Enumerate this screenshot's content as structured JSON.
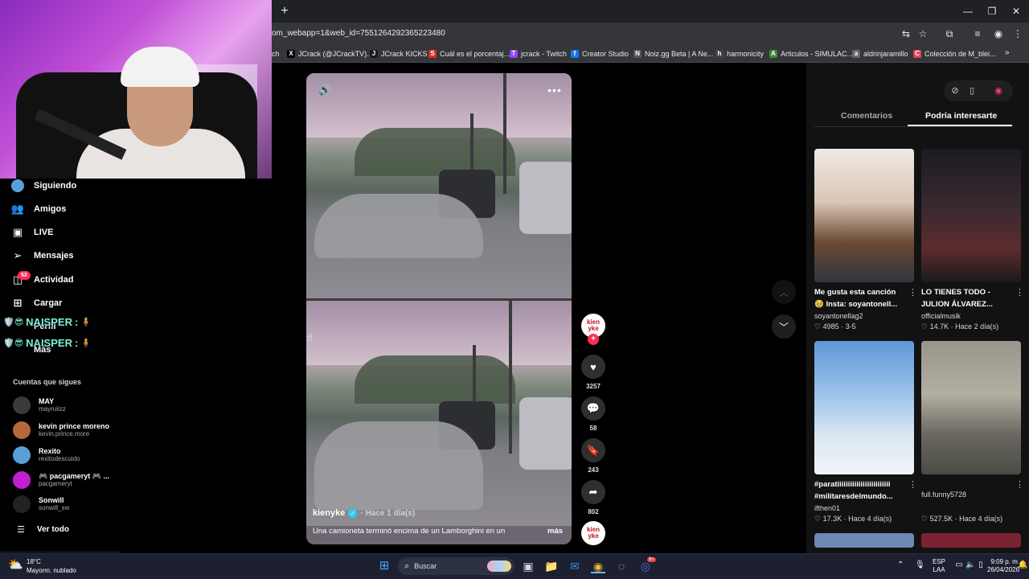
{
  "browser": {
    "url": "om_webapp=1&web_id=7551264292365223480",
    "new_tab": "+",
    "bookmarks": [
      {
        "label": "ch",
        "icon": "",
        "color": "#35363a"
      },
      {
        "label": "JCrack (@JCrackTV)...",
        "icon": "X",
        "color": "#000000"
      },
      {
        "label": "JCrack KICKS",
        "icon": "J",
        "color": "#1a1a1a"
      },
      {
        "label": "Cuál es el porcentaj...",
        "icon": "S",
        "color": "#d32f2f"
      },
      {
        "label": "jcrack - Twitch",
        "icon": "T",
        "color": "#9146ff"
      },
      {
        "label": "Creator Studio",
        "icon": "f",
        "color": "#1877f2"
      },
      {
        "label": "Noiz.gg Beta | A Ne...",
        "icon": "N",
        "color": "#555555"
      },
      {
        "label": "harmonicity",
        "icon": "h",
        "color": "#444444"
      },
      {
        "label": "Articulos - SIMULAC...",
        "icon": "A",
        "color": "#3c8d2f"
      },
      {
        "label": "aldrinjaramillo",
        "icon": "a",
        "color": "#666666"
      },
      {
        "label": "Colección de M_blei...",
        "icon": "C",
        "color": "#e4405f"
      }
    ],
    "bookmarks_overflow": "»"
  },
  "sidebar": {
    "nav": [
      {
        "label": "Siguiendo",
        "icon": "avatar"
      },
      {
        "label": "Amigos",
        "icon": "👥"
      },
      {
        "label": "LIVE",
        "icon": "▣"
      },
      {
        "label": "Mensajes",
        "icon": "➢"
      },
      {
        "label": "Actividad",
        "icon": "◫"
      },
      {
        "label": "Cargar",
        "icon": "⊞"
      },
      {
        "label": "Perfil",
        "icon": ""
      },
      {
        "label": "Más",
        "icon": ""
      }
    ],
    "activity_badge": "53",
    "chat_overlay": [
      {
        "name": "NAISPER",
        "sep": ":"
      },
      {
        "name": "NAISPER",
        "sep": ":"
      }
    ],
    "following_title": "Cuentas que sigues",
    "accounts": [
      {
        "name": "MAY",
        "handle": "mayruiizz",
        "color": "#3a3a3a"
      },
      {
        "name": "kevin prince moreno",
        "handle": "kevin.prince.more",
        "color": "#b5693a"
      },
      {
        "name": "Rexito",
        "handle": "rexitodescuido",
        "color": "#5aa0d8"
      },
      {
        "name": "🎮 pacgameryt 🎮 ...",
        "handle": "pacgameryt",
        "color": "#c21fd1"
      },
      {
        "name": "Sonwill",
        "handle": "sonwill_sw",
        "color": "#222222"
      }
    ],
    "see_all": "Ver todo"
  },
  "video": {
    "author": "kienyke",
    "date": "· Hace 1 día(s)",
    "caption": "Una camioneta terminó encima de un Lamborghini en un",
    "more": "más",
    "likes": "3257",
    "comments": "58",
    "saves": "243",
    "shares": "802",
    "creator_logo": "kien\nyke"
  },
  "right_panel": {
    "tabs": [
      {
        "label": "Comentarios",
        "active": false
      },
      {
        "label": "Podría interesarte",
        "active": true
      }
    ],
    "cards": [
      {
        "title1": "Me gusta esta canción",
        "title2": "🥹 Insta: soyantonell...",
        "author": "soyantonellag2",
        "likes": "♡ 4985",
        "date": "· 3-5",
        "thumb": "linear-gradient(180deg,#efe9e4 0%,#d9c6b6 40%,#6b4a35 70%,#2f3640 100%)"
      },
      {
        "title1": "LO TIENES TODO -",
        "title2": "JULION ÁLVAREZ...",
        "author": "officialmusik",
        "likes": "♡ 14.7K",
        "date": "· Hace 2 día(s)",
        "thumb": "linear-gradient(180deg,#1b1b22 0%,#3a2a30 45%,#5e2b2d 75%,#1a1a1a 100%)"
      },
      {
        "title1": "#paratiiiiiiiiiiiiiiiiiiiiiiiii",
        "title2": "#militaresdelmundo...",
        "author": "ifthen01",
        "likes": "♡ 17.3K",
        "date": "· Hace 4 día(s)",
        "thumb": "linear-gradient(180deg,#5f97d8 0%,#9cc3ea 40%,#d8e7f3 70%,#f1f4f7 100%)"
      },
      {
        "title1": "",
        "title2": "full.funny5728",
        "author": "",
        "likes": "♡ 527.5K",
        "date": "· Hace 4 día(s)",
        "thumb": "linear-gradient(180deg,#9a958c 0%,#b3aea2 40%,#6a6860 70%,#4b4a45 100%)"
      }
    ]
  },
  "taskbar": {
    "temp": "18°C",
    "weather": "Mayorm. nublado",
    "search": "Buscar",
    "lang1": "ESP",
    "lang2": "LAA",
    "time": "9:09 p. m.",
    "date": "26/04/2026",
    "discord_badge": "9+"
  },
  "colors": {
    "accent": "#fe2c55",
    "verified": "#20d5ec"
  }
}
